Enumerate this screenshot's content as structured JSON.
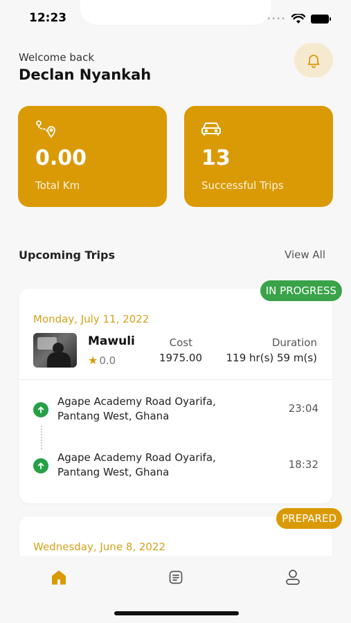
{
  "status_bar": {
    "time": "12:23"
  },
  "header": {
    "welcome_text": "Welcome back",
    "user_name": "Declan Nyankah",
    "bell_icon": "bell-icon"
  },
  "stats": [
    {
      "icon": "route-icon",
      "value": "0.00",
      "label": "Total Km"
    },
    {
      "icon": "car-icon",
      "value": "13",
      "label": "Successful Trips"
    }
  ],
  "upcoming": {
    "title": "Upcoming Trips",
    "view_all": "View All"
  },
  "trips": [
    {
      "status": "IN PROGRESS",
      "date": "Monday, July 11, 2022",
      "driver": "Mawuli",
      "rating": "0.0",
      "cost_label": "Cost",
      "cost": "1975.00",
      "duration_label": "Duration",
      "duration": "119 hr(s) 59 m(s)",
      "stops": [
        {
          "address": "Agape Academy Road Oyarifa, Pantang West, Ghana",
          "time": "23:04"
        },
        {
          "address": "Agape Academy Road Oyarifa, Pantang West, Ghana",
          "time": "18:32"
        }
      ]
    },
    {
      "status": "PREPARED",
      "date": "Wednesday, June 8, 2022"
    }
  ],
  "nav": [
    {
      "icon": "home-icon"
    },
    {
      "icon": "trips-list-icon"
    },
    {
      "icon": "profile-icon"
    }
  ],
  "colors": {
    "accent": "#d99a06",
    "success": "#3aa34a",
    "date_text": "#d4a21a",
    "background": "#f7f7f8"
  }
}
